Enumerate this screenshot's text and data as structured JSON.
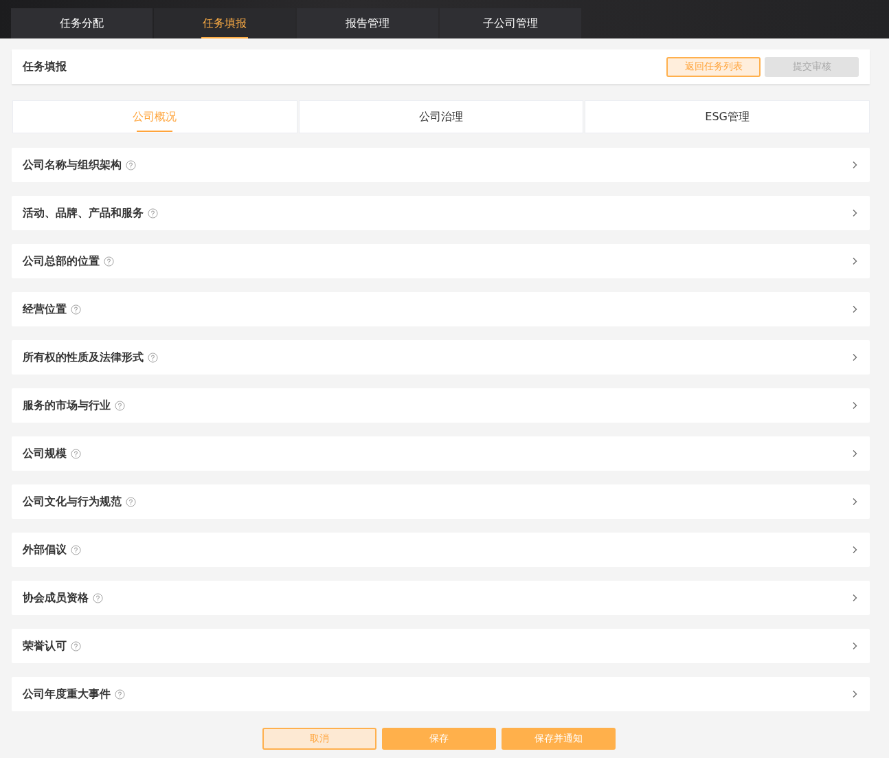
{
  "nav_tabs": [
    {
      "label": "任务分配",
      "selected": false
    },
    {
      "label": "任务填报",
      "selected": true
    },
    {
      "label": "报告管理",
      "selected": false
    },
    {
      "label": "子公司管理",
      "selected": false
    }
  ],
  "header": {
    "title": "任务填报",
    "buttons": [
      {
        "label": "返回任务列表",
        "kind": "outline"
      },
      {
        "label": "提交审核",
        "kind": "disabled"
      }
    ]
  },
  "section_tabs": [
    {
      "label": "公司概况",
      "selected": true
    },
    {
      "label": "公司治理",
      "selected": false
    },
    {
      "label": "ESG管理",
      "selected": false
    }
  ],
  "sections": [
    {
      "title": "公司名称与组织架构"
    },
    {
      "title": "活动、品牌、产品和服务"
    },
    {
      "title": "公司总部的位置"
    },
    {
      "title": "经营位置"
    },
    {
      "title": "所有权的性质及法律形式"
    },
    {
      "title": "服务的市场与行业"
    },
    {
      "title": "公司规模"
    },
    {
      "title": "公司文化与行为规范"
    },
    {
      "title": "外部倡议"
    },
    {
      "title": "协会成员资格"
    },
    {
      "title": "荣誉认可"
    },
    {
      "title": "公司年度重大事件"
    }
  ],
  "footer_buttons": [
    {
      "label": "取消",
      "kind": "outline"
    },
    {
      "label": "保存",
      "kind": "primary"
    },
    {
      "label": "保存并通知",
      "kind": "primary"
    }
  ]
}
